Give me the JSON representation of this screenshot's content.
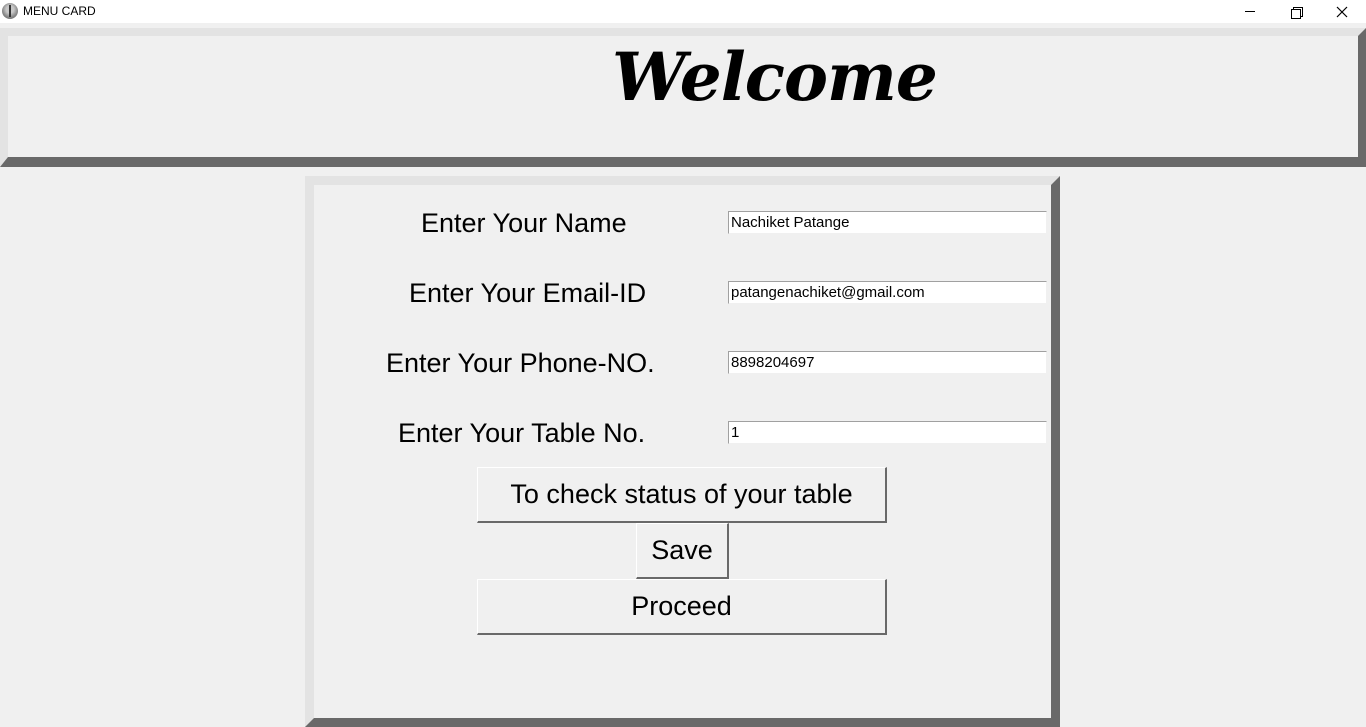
{
  "window": {
    "title": "MENU CARD",
    "controls": {
      "minimize": "minimize",
      "maximize": "restore",
      "close": "close"
    }
  },
  "header": {
    "welcome": "Welcome"
  },
  "form": {
    "name_label": "Enter Your Name",
    "name_value": "Nachiket Patange",
    "email_label": "Enter Your Email-ID",
    "email_value": "patangenachiket@gmail.com",
    "phone_label": "Enter Your Phone-NO.",
    "phone_value": "8898204697",
    "table_label": "Enter Your Table No.",
    "table_value": "1",
    "status_button": "To check status of your table",
    "save_button": "Save",
    "proceed_button": "Proceed"
  },
  "colors": {
    "background": "#f0f0f0",
    "frame_light": "#e3e3e3",
    "frame_dark": "#696969"
  }
}
